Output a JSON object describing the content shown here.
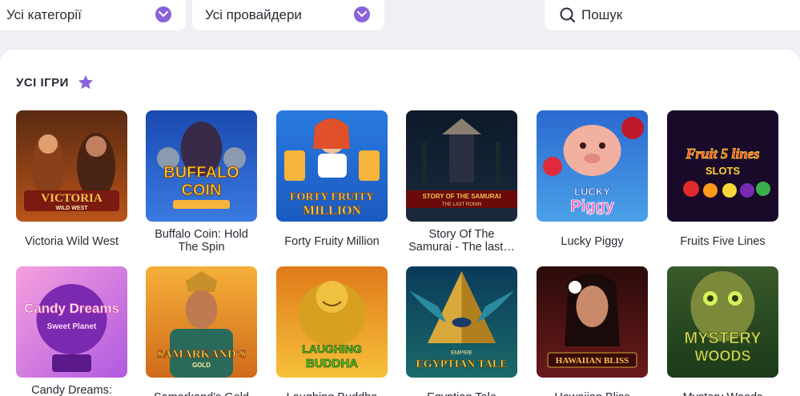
{
  "filters": {
    "categories_label": "Усі категорії",
    "providers_label": "Усі провайдери",
    "search_placeholder": "Пошук"
  },
  "section": {
    "title": "УСІ ІГРИ"
  },
  "games": [
    {
      "name": "Victoria Wild West",
      "logo": "VICTORIA",
      "logo2": "WILD WEST"
    },
    {
      "name": "Buffalo Coin: Hold The Spin",
      "logo": "BUFFALO",
      "logo2": "COIN"
    },
    {
      "name": "Forty Fruity Million",
      "logo": "FORTY FRUITY",
      "logo2": "MILLION"
    },
    {
      "name": "Story Of The Samurai - The last…",
      "logo": "STORY OF THE SAMURAI",
      "logo2": "THE LAST RONIN"
    },
    {
      "name": "Lucky Piggy",
      "logo": "LUCKY",
      "logo2": "Piggy"
    },
    {
      "name": "Fruits Five Lines",
      "logo": "Fruit 5 lines",
      "logo2": "SLOTS"
    },
    {
      "name": "Candy Dreams: Sweet Planet",
      "logo": "Candy Dreams",
      "logo2": "Sweet Planet"
    },
    {
      "name": "Samarkand’s Gold",
      "logo": "SAMARKAND'S",
      "logo2": "GOLD"
    },
    {
      "name": "Laughing Buddha",
      "logo": "LAUGHING",
      "logo2": "BUDDHA"
    },
    {
      "name": "Egyptian Tale",
      "logo": "EGYPTIAN TALE",
      "logo2": "EMPIRE"
    },
    {
      "name": "Hawaiian Bliss",
      "logo": "HAWAIIAN BLISS",
      "logo2": ""
    },
    {
      "name": "Mystery Woods",
      "logo": "MYSTERY",
      "logo2": "WOODS"
    }
  ],
  "colors": {
    "accent": "#8b63d9",
    "page_bg": "#eef0f5"
  }
}
